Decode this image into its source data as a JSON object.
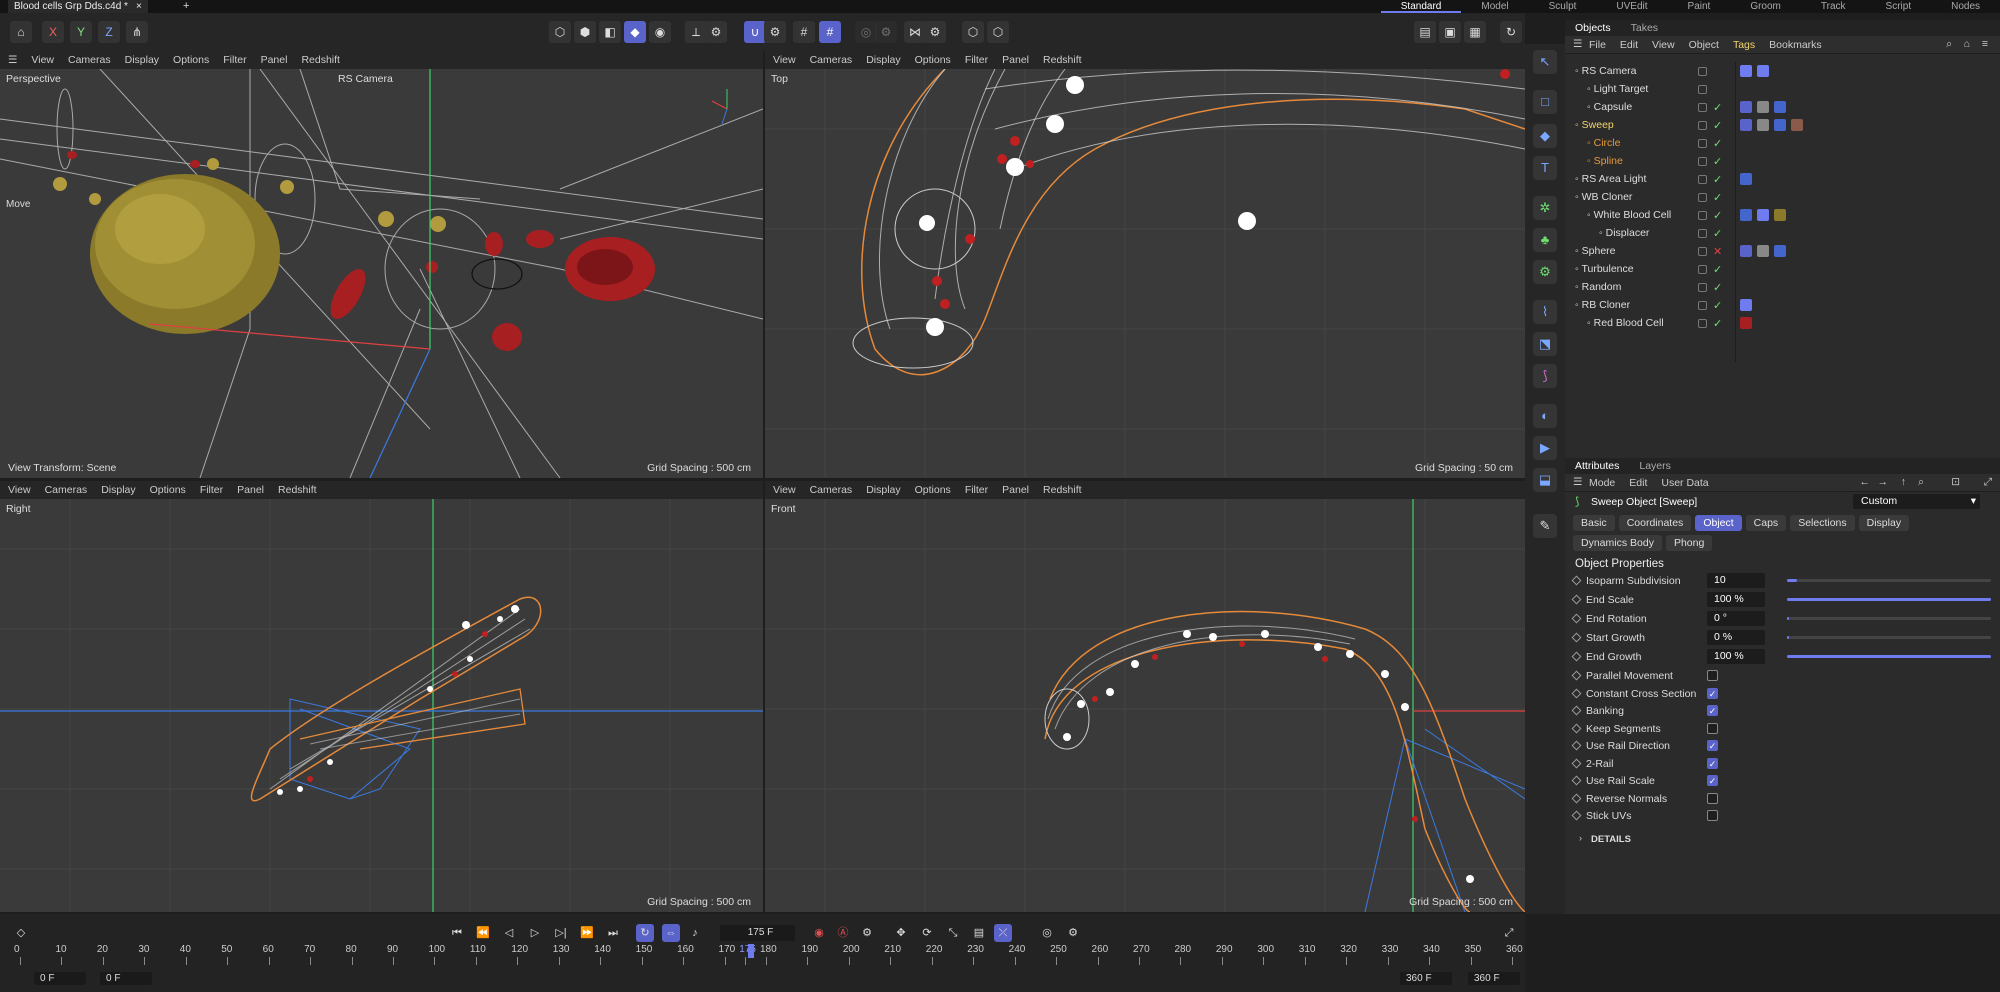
{
  "document": {
    "tab_title": "Blood cells Grp Dds.c4d *",
    "add_tab": "+"
  },
  "layouts": [
    "Standard",
    "Model",
    "Sculpt",
    "UVEdit",
    "Paint",
    "Groom",
    "Track",
    "Script",
    "Nodes"
  ],
  "axis_toggles": [
    "X",
    "Y",
    "Z"
  ],
  "viewports": {
    "menu": [
      "View",
      "Cameras",
      "Display",
      "Options",
      "Filter",
      "Panel",
      "Redshift"
    ],
    "perspective": {
      "label": "Perspective",
      "camera": "RS Camera",
      "tool": "Move",
      "transform": "View Transform: Scene",
      "grid": "Grid Spacing : 500 cm"
    },
    "top": {
      "label": "Top",
      "grid": "Grid Spacing : 50 cm"
    },
    "right": {
      "label": "Right",
      "grid": "Grid Spacing : 500 cm"
    },
    "front": {
      "label": "Front",
      "grid": "Grid Spacing : 500 cm"
    }
  },
  "objects_panel": {
    "tabs": [
      "Objects",
      "Takes"
    ],
    "menu": [
      "File",
      "Edit",
      "View",
      "Object",
      "Tags",
      "Bookmarks"
    ],
    "rows": [
      {
        "name": "RS Camera",
        "indent": 0,
        "color": "#ddd",
        "status": ""
      },
      {
        "name": "Light Target",
        "indent": 1,
        "color": "#ddd",
        "status": ""
      },
      {
        "name": "Capsule",
        "indent": 1,
        "color": "#ddd",
        "status": "✓"
      },
      {
        "name": "Sweep",
        "indent": 0,
        "color": "#f3d36a",
        "status": "✓"
      },
      {
        "name": "Circle",
        "indent": 1,
        "color": "#e59a3a",
        "status": "✓"
      },
      {
        "name": "Spline",
        "indent": 1,
        "color": "#e59a3a",
        "status": "✓"
      },
      {
        "name": "RS Area Light",
        "indent": 0,
        "color": "#ddd",
        "status": "✓"
      },
      {
        "name": "WB Cloner",
        "indent": 0,
        "color": "#ddd",
        "status": "✓"
      },
      {
        "name": "White Blood Cell",
        "indent": 1,
        "color": "#ddd",
        "status": "✓"
      },
      {
        "name": "Displacer",
        "indent": 2,
        "color": "#ddd",
        "status": "✓"
      },
      {
        "name": "Sphere",
        "indent": 0,
        "color": "#ddd",
        "status": "✕"
      },
      {
        "name": "Turbulence",
        "indent": 0,
        "color": "#ddd",
        "status": "✓"
      },
      {
        "name": "Random",
        "indent": 0,
        "color": "#ddd",
        "status": "✓"
      },
      {
        "name": "RB Cloner",
        "indent": 0,
        "color": "#ddd",
        "status": "✓"
      },
      {
        "name": "Red Blood Cell",
        "indent": 1,
        "color": "#ddd",
        "status": "✓"
      }
    ]
  },
  "attributes_panel": {
    "tabs": [
      "Attributes",
      "Layers"
    ],
    "menu": [
      "Mode",
      "Edit",
      "User Data"
    ],
    "object_title": "Sweep Object [Sweep]",
    "preset": "Custom",
    "subtabs": [
      "Basic",
      "Coordinates",
      "Object",
      "Caps",
      "Selections",
      "Display",
      "Dynamics Body",
      "Phong"
    ],
    "active_subtab": "Object",
    "section": "Object Properties",
    "numeric": [
      {
        "label": "Isoparm Subdivision",
        "value": "10",
        "fill": 0.05
      },
      {
        "label": "End Scale",
        "value": "100 %",
        "fill": 1.0
      },
      {
        "label": "End Rotation",
        "value": "0 °",
        "fill": 0.0
      },
      {
        "label": "Start Growth",
        "value": "0 %",
        "fill": 0.0
      },
      {
        "label": "End Growth",
        "value": "100 %",
        "fill": 1.0
      }
    ],
    "checks": [
      {
        "label": "Parallel Movement",
        "on": false
      },
      {
        "label": "Constant Cross Section",
        "on": true
      },
      {
        "label": "Banking",
        "on": true
      },
      {
        "label": "Keep Segments",
        "on": false
      },
      {
        "label": "Use Rail Direction",
        "on": true
      },
      {
        "label": "2-Rail",
        "on": true
      },
      {
        "label": "Use Rail Scale",
        "on": true
      },
      {
        "label": "Reverse Normals",
        "on": false
      },
      {
        "label": "Stick UVs",
        "on": false
      }
    ],
    "details": "DETAILS"
  },
  "timeline": {
    "current_frame": "175 F",
    "start_field": "0 F",
    "start_field2": "0 F",
    "end_field": "360 F",
    "end_field2": "360 F",
    "ticks": [
      "0",
      "10",
      "20",
      "30",
      "40",
      "50",
      "60",
      "70",
      "80",
      "90",
      "100",
      "110",
      "120",
      "130",
      "140",
      "150",
      "160",
      "170",
      "175",
      "180",
      "190",
      "200",
      "210",
      "220",
      "230",
      "240",
      "250",
      "260",
      "270",
      "280",
      "290",
      "300",
      "310",
      "320",
      "330",
      "340",
      "350",
      "360"
    ]
  }
}
